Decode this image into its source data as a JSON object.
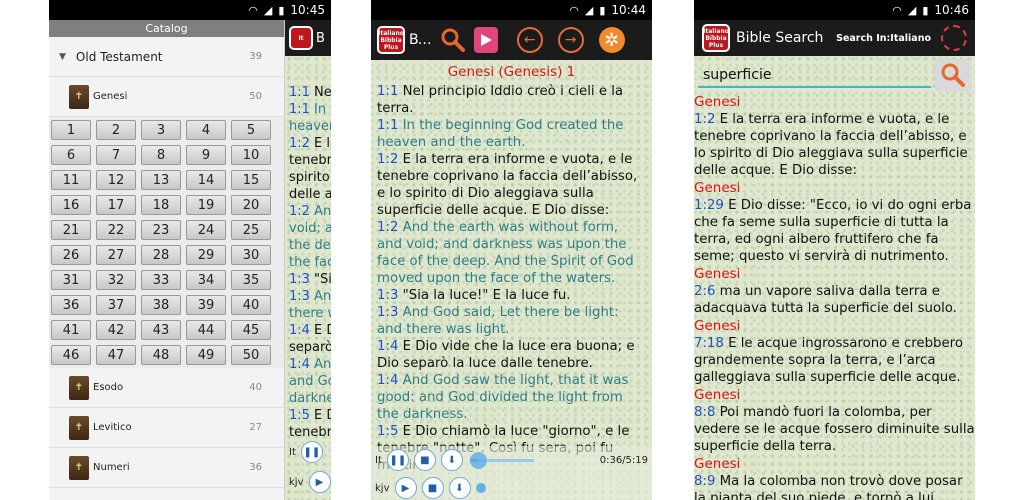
{
  "status": {
    "p1_time": "10:45",
    "p2_time": "10:44",
    "p3_time": "10:46",
    "wifi_icon": "wifi-icon",
    "signal_icon": "signal-icon",
    "battery_icon": "battery-icon"
  },
  "app": {
    "logo_lines": [
      "Italiano",
      "Bibbia",
      "Plus"
    ],
    "logo_color": "#c0151d"
  },
  "catalog": {
    "title": "Catalog",
    "testament": {
      "label": "Old Testament",
      "count": "39"
    },
    "books": [
      {
        "label": "Genesi",
        "count": "50"
      },
      {
        "label": "Esodo",
        "count": "40"
      },
      {
        "label": "Levitico",
        "count": "27"
      },
      {
        "label": "Numeri",
        "count": "36"
      }
    ],
    "chapters": [
      "1",
      "2",
      "3",
      "4",
      "5",
      "6",
      "7",
      "8",
      "9",
      "10",
      "11",
      "12",
      "13",
      "14",
      "15",
      "16",
      "17",
      "18",
      "19",
      "20",
      "21",
      "22",
      "23",
      "24",
      "25",
      "26",
      "27",
      "28",
      "29",
      "30",
      "31",
      "32",
      "33",
      "34",
      "35",
      "36",
      "37",
      "38",
      "39",
      "40",
      "41",
      "42",
      "43",
      "44",
      "45",
      "46",
      "47",
      "48",
      "49",
      "50"
    ]
  },
  "behind": {
    "title_partial": "B",
    "lines": [
      {
        "ref": "1:1",
        "text": " Ne",
        "cls": "it"
      },
      {
        "ref": "1:1",
        "text": " In t",
        "cls": "en"
      },
      {
        "ref": "",
        "text": "heaven",
        "cls": "en"
      },
      {
        "ref": "1:2",
        "text": " E la",
        "cls": "it"
      },
      {
        "ref": "",
        "text": "tenebre",
        "cls": "it"
      },
      {
        "ref": "",
        "text": "spirito",
        "cls": "it"
      },
      {
        "ref": "",
        "text": "delle a",
        "cls": "it"
      },
      {
        "ref": "1:2",
        "text": " An",
        "cls": "en"
      },
      {
        "ref": "",
        "text": "void; a",
        "cls": "en"
      },
      {
        "ref": "",
        "text": "the dee",
        "cls": "en"
      },
      {
        "ref": "",
        "text": "the fac",
        "cls": "en"
      },
      {
        "ref": "1:3",
        "text": " \"Sia",
        "cls": "it"
      },
      {
        "ref": "1:3",
        "text": " An",
        "cls": "en"
      },
      {
        "ref": "",
        "text": "there w",
        "cls": "en"
      },
      {
        "ref": "1:4",
        "text": " E D",
        "cls": "it"
      },
      {
        "ref": "",
        "text": "separò",
        "cls": "it"
      },
      {
        "ref": "1:4",
        "text": " An",
        "cls": "en"
      },
      {
        "ref": "",
        "text": "and Go",
        "cls": "en"
      },
      {
        "ref": "",
        "text": "darkne",
        "cls": "en"
      },
      {
        "ref": "1:5",
        "text": " E D",
        "cls": "it"
      },
      {
        "ref": "",
        "text": "tenebr",
        "cls": "it"
      }
    ],
    "ctrl_label_1": "It",
    "ctrl_label_2": "kjv"
  },
  "reader": {
    "heading": "Genesi (Genesis) 1",
    "verses": [
      {
        "ref": "1:1",
        "text": " Nel principio Iddio creò i cieli e la terra.",
        "cls": "it"
      },
      {
        "ref": "1:1",
        "text": " In the beginning God created the heaven and the earth.",
        "cls": "en"
      },
      {
        "ref": "1:2",
        "text": " E la terra era informe e vuota, e le tenebre coprivano la faccia dell’abisso, e lo spirito di Dio aleggiava sulla superficie delle acque. E Dio disse:",
        "cls": "it"
      },
      {
        "ref": "1:2",
        "text": " And the earth was without form, and void; and darkness was upon the face of the deep. And the Spirit of God moved upon the face of the waters.",
        "cls": "en"
      },
      {
        "ref": "1:3",
        "text": " \"Sia la luce!\" E la luce fu.",
        "cls": "it"
      },
      {
        "ref": "1:3",
        "text": " And God said, Let there be light: and there was light.",
        "cls": "en"
      },
      {
        "ref": "1:4",
        "text": " E Dio vide che la luce era buona; e Dio separò la luce dalle tenebre.",
        "cls": "it"
      },
      {
        "ref": "1:4",
        "text": " And God saw the light, that it was good: and God divided the light from the darkness.",
        "cls": "en"
      },
      {
        "ref": "1:5",
        "text": " E Dio chiamò la luce \"giorno\", e le tenebre \"notte\". Così fu sera, poi fu mattina:",
        "cls": "it"
      }
    ],
    "ctrl_label_1": "It",
    "ctrl_label_2": "kjv",
    "time": "0:36/5:19",
    "progress": 0.12
  },
  "search": {
    "title": "Bible Search",
    "search_in": "Search In:Italiano",
    "query": "superficie",
    "results": [
      {
        "book": "Genesi",
        "ref": "1:2",
        "text": " E la terra era informe e vuota, e le tenebre coprivano la faccia dell’abisso, e lo spirito di Dio aleggiava sulla superficie delle acque. E Dio disse:"
      },
      {
        "book": "Genesi",
        "ref": "1:29",
        "text": " E Dio disse: \"Ecco, io vi do ogni erba che fa seme sulla superficie di tutta la terra, ed ogni albero fruttifero che fa seme; questo vi servirà di nutrimento."
      },
      {
        "book": "Genesi",
        "ref": "2:6",
        "text": " ma un vapore saliva dalla terra e adacquava tutta la superficie del suolo."
      },
      {
        "book": "Genesi",
        "ref": "7:18",
        "text": " E le acque ingrossarono e crebbero grandemente sopra la terra, e l’arca galleggiava sulla superficie delle acque."
      },
      {
        "book": "Genesi",
        "ref": "8:8",
        "text": " Poi mandò fuori la colomba, per vedere se le acque fossero diminuite sulla superficie della terra."
      },
      {
        "book": "Genesi",
        "ref": "8:9",
        "text": " Ma la colomba non trovò dove posar la pianta del suo piede, e tornò a lui nell’arca"
      }
    ]
  }
}
